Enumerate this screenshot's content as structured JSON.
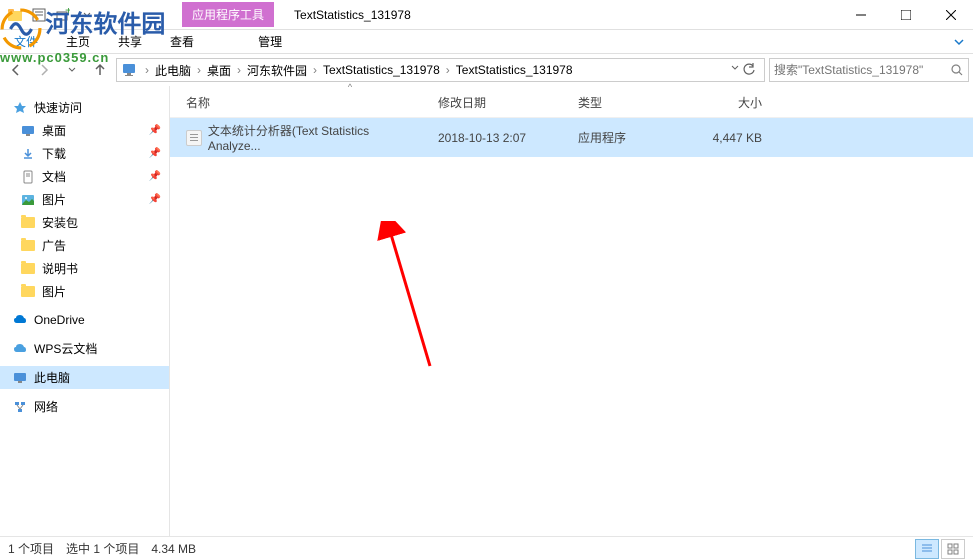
{
  "titlebar": {
    "app_tools_label": "应用程序工具",
    "window_title": "TextStatistics_131978"
  },
  "ribbon": {
    "file": "文件",
    "home": "主页",
    "share": "共享",
    "view": "查看",
    "manage": "管理"
  },
  "breadcrumb": {
    "root": "此电脑",
    "items": [
      "桌面",
      "河东软件园",
      "TextStatistics_131978",
      "TextStatistics_131978"
    ]
  },
  "search": {
    "placeholder": "搜索\"TextStatistics_131978\""
  },
  "navpane": {
    "quick_access": "快速访问",
    "desktop": "桌面",
    "downloads": "下载",
    "documents": "文档",
    "pictures": "图片",
    "folders": [
      "安装包",
      "广告",
      "说明书",
      "图片"
    ],
    "onedrive": "OneDrive",
    "wps": "WPS云文档",
    "thispc": "此电脑",
    "network": "网络"
  },
  "columns": {
    "name": "名称",
    "date": "修改日期",
    "type": "类型",
    "size": "大小"
  },
  "files": [
    {
      "name": "文本统计分析器(Text Statistics Analyze...",
      "date": "2018-10-13 2:07",
      "type": "应用程序",
      "size": "4,447 KB"
    }
  ],
  "statusbar": {
    "items": "1 个项目",
    "selected": "选中 1 个项目",
    "size": "4.34 MB"
  },
  "watermark": {
    "text": "河东软件园",
    "url": "www.pc0359.cn"
  }
}
